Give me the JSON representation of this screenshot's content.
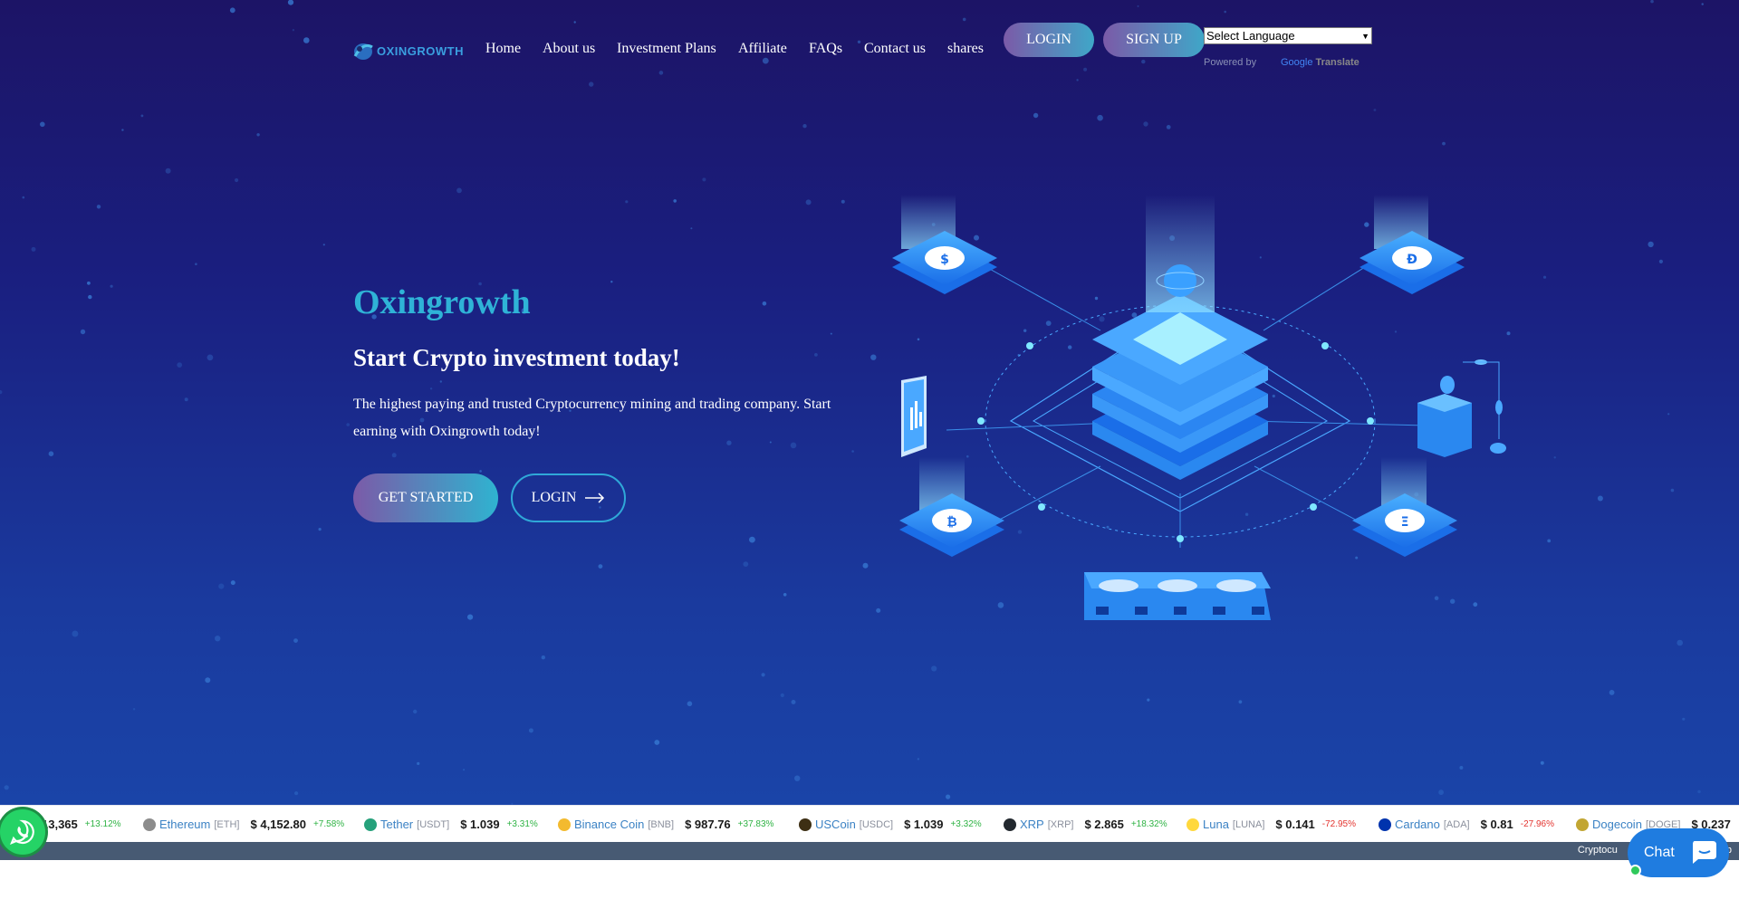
{
  "brand": {
    "logo_text": "OXINGROWTH"
  },
  "nav": {
    "items": [
      {
        "label": "Home"
      },
      {
        "label": "About us"
      },
      {
        "label": "Investment Plans"
      },
      {
        "label": "Affiliate"
      },
      {
        "label": "FAQs"
      },
      {
        "label": "Contact us"
      },
      {
        "label": "shares"
      }
    ],
    "login_label": "LOGIN",
    "signup_label": "SIGN UP"
  },
  "translate": {
    "select_value": "Select Language",
    "powered_by": "Powered by",
    "google": "Google",
    "translate": "Translate"
  },
  "hero": {
    "title": "Oxingrowth",
    "subtitle": "Start Crypto investment today!",
    "description": "The highest paying and trusted Cryptocurrency mining and trading company. Start earning with Oxingrowth today!",
    "get_started_label": "GET STARTED",
    "login_label": "LOGIN"
  },
  "ticker": [
    {
      "name": "",
      "symbol": "",
      "price": "13,365",
      "change": "+13.12%",
      "trend": "up",
      "icon_color": "#f7931a",
      "icon": "bitcoin-icon"
    },
    {
      "name": "Ethereum",
      "symbol": "[ETH]",
      "price": "$ 4,152.80",
      "change": "+7.58%",
      "trend": "up",
      "icon_color": "#8c8c8c",
      "icon": "ethereum-icon"
    },
    {
      "name": "Tether",
      "symbol": "[USDT]",
      "price": "$ 1.039",
      "change": "+3.31%",
      "trend": "up",
      "icon_color": "#26a17b",
      "icon": "tether-icon"
    },
    {
      "name": "Binance Coin",
      "symbol": "[BNB]",
      "price": "$ 987.76",
      "change": "+37.83%",
      "trend": "up",
      "icon_color": "#f3ba2f",
      "icon": "binance-icon"
    },
    {
      "name": "USCoin",
      "symbol": "[USDC]",
      "price": "$ 1.039",
      "change": "+3.32%",
      "trend": "up",
      "icon_color": "#3d2f14",
      "icon": "uscoin-icon"
    },
    {
      "name": "XRP",
      "symbol": "[XRP]",
      "price": "$ 2.865",
      "change": "+18.32%",
      "trend": "up",
      "icon_color": "#23292f",
      "icon": "xrp-icon"
    },
    {
      "name": "Luna",
      "symbol": "[LUNA]",
      "price": "$ 0.141",
      "change": "-72.95%",
      "trend": "down",
      "icon_color": "#ffd83d",
      "icon": "luna-icon"
    },
    {
      "name": "Cardano",
      "symbol": "[ADA]",
      "price": "$ 0.81",
      "change": "-27.96%",
      "trend": "down",
      "icon_color": "#0033ad",
      "icon": "cardano-icon"
    },
    {
      "name": "Dogecoin",
      "symbol": "[DOGE]",
      "price": "$ 0.237",
      "change": "",
      "trend": "up",
      "icon_color": "#c2a633",
      "icon": "dogecoin-icon"
    }
  ],
  "attribution": "Cryptocu",
  "attribution_tail": "b",
  "chat": {
    "label": "Chat"
  },
  "colors": {
    "accent": "#2fb3d7",
    "bg_top": "#1c1466",
    "bg_bottom": "#1a44a8"
  }
}
